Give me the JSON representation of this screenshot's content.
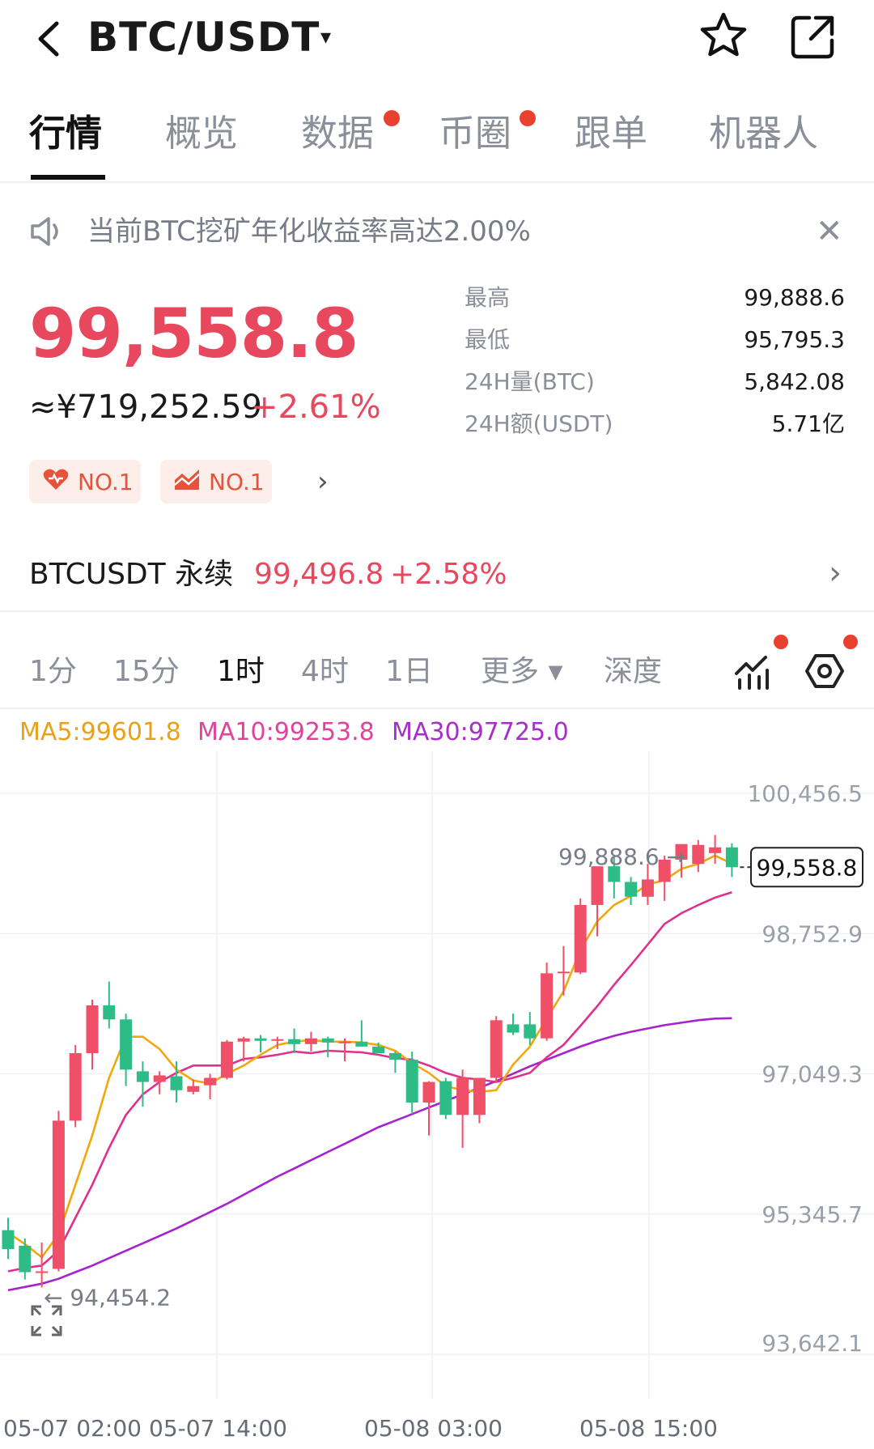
{
  "header": {
    "pair": "BTC/USDT",
    "dropdown_glyph": "▾",
    "icons": [
      "back-icon",
      "star-icon",
      "share-icon"
    ]
  },
  "tabs": [
    {
      "label": "行情",
      "active": true,
      "dot": false
    },
    {
      "label": "概览",
      "active": false,
      "dot": false
    },
    {
      "label": "数据",
      "active": false,
      "dot": true
    },
    {
      "label": "币圈",
      "active": false,
      "dot": true
    },
    {
      "label": "跟单",
      "active": false,
      "dot": false
    },
    {
      "label": "机器人",
      "active": false,
      "dot": false
    }
  ],
  "notice": {
    "text": "当前BTC挖矿年化收益率高达2.00%",
    "close": "✕"
  },
  "ticker": {
    "price": "99,558.8",
    "cny": "≈¥719,252.59",
    "change": "+2.61%",
    "badges": [
      "NO.1",
      "NO.1"
    ],
    "badge_arrow": "›",
    "stats": [
      {
        "label": "最高",
        "value": "99,888.6"
      },
      {
        "label": "最低",
        "value": "95,795.3"
      },
      {
        "label": "24H量(BTC)",
        "value": "5,842.08"
      },
      {
        "label": "24H额(USDT)",
        "value": "5.71亿"
      }
    ]
  },
  "perpetual": {
    "name": "BTCUSDT 永续",
    "price": "99,496.8",
    "change": "+2.58%",
    "arrow": "›"
  },
  "intervals": [
    {
      "label": "1分",
      "active": false
    },
    {
      "label": "15分",
      "active": false
    },
    {
      "label": "1时",
      "active": true
    },
    {
      "label": "4时",
      "active": false
    },
    {
      "label": "1日",
      "active": false
    },
    {
      "label": "更多 ▾",
      "active": false
    },
    {
      "label": "深度",
      "active": false
    }
  ],
  "ma_legend": [
    {
      "label": "MA5:99601.8",
      "color": "#e8a21a"
    },
    {
      "label": "MA10:99253.8",
      "color": "#e0439a"
    },
    {
      "label": "MA30:97725.0",
      "color": "#a72fc9"
    }
  ],
  "colors": {
    "up": "#ef5068",
    "down": "#2dbc85",
    "ma5": "#f0a80c",
    "ma10": "#e0308e",
    "ma30": "#a722cf"
  },
  "chart_data": {
    "type": "candlestick",
    "y_ticks": [
      "100,456.5",
      "98,752.9",
      "97,049.3",
      "95,345.7",
      "93,642.1"
    ],
    "y_tick_values": [
      100456.5,
      98752.9,
      97049.3,
      95345.7,
      93642.1
    ],
    "ylim": [
      93642.1,
      100456.5
    ],
    "x_ticks": [
      "05-07 02:00",
      "05-07 14:00",
      "05-08 03:00",
      "05-08 15:00"
    ],
    "high_label": "99,888.6 →",
    "low_label": "← 94,454.2",
    "last_price_label": "99,558.8",
    "last_price": 99558.8,
    "candles": [
      {
        "o": 95150,
        "h": 95300,
        "l": 94800,
        "c": 94920
      },
      {
        "o": 94960,
        "h": 95050,
        "l": 94550,
        "c": 94640
      },
      {
        "o": 94630,
        "h": 95000,
        "l": 94454.2,
        "c": 94650
      },
      {
        "o": 94680,
        "h": 96600,
        "l": 94650,
        "c": 96480
      },
      {
        "o": 96480,
        "h": 97400,
        "l": 96400,
        "c": 97300
      },
      {
        "o": 97300,
        "h": 97950,
        "l": 97100,
        "c": 97880
      },
      {
        "o": 97880,
        "h": 98170,
        "l": 97600,
        "c": 97710
      },
      {
        "o": 97710,
        "h": 97780,
        "l": 96900,
        "c": 97100
      },
      {
        "o": 97080,
        "h": 97200,
        "l": 96650,
        "c": 96950
      },
      {
        "o": 96950,
        "h": 97080,
        "l": 96800,
        "c": 97030
      },
      {
        "o": 97020,
        "h": 97200,
        "l": 96700,
        "c": 96850
      },
      {
        "o": 96830,
        "h": 96980,
        "l": 96800,
        "c": 96900
      },
      {
        "o": 96910,
        "h": 97050,
        "l": 96740,
        "c": 97000
      },
      {
        "o": 97000,
        "h": 97460,
        "l": 96980,
        "c": 97440
      },
      {
        "o": 97440,
        "h": 97500,
        "l": 97200,
        "c": 97480
      },
      {
        "o": 97480,
        "h": 97520,
        "l": 97310,
        "c": 97450
      },
      {
        "o": 97450,
        "h": 97500,
        "l": 97350,
        "c": 97470
      },
      {
        "o": 97470,
        "h": 97600,
        "l": 97300,
        "c": 97410
      },
      {
        "o": 97410,
        "h": 97560,
        "l": 97320,
        "c": 97480
      },
      {
        "o": 97480,
        "h": 97500,
        "l": 97250,
        "c": 97430
      },
      {
        "o": 97430,
        "h": 97480,
        "l": 97200,
        "c": 97440
      },
      {
        "o": 97440,
        "h": 97700,
        "l": 97400,
        "c": 97380
      },
      {
        "o": 97380,
        "h": 97430,
        "l": 97300,
        "c": 97300
      },
      {
        "o": 97300,
        "h": 97320,
        "l": 97060,
        "c": 97220
      },
      {
        "o": 97220,
        "h": 97320,
        "l": 96560,
        "c": 96700
      },
      {
        "o": 96700,
        "h": 96960,
        "l": 96300,
        "c": 96950
      },
      {
        "o": 96960,
        "h": 97000,
        "l": 96500,
        "c": 96550
      },
      {
        "o": 96550,
        "h": 97100,
        "l": 96150,
        "c": 97000
      },
      {
        "o": 96550,
        "h": 97000,
        "l": 96450,
        "c": 97000
      },
      {
        "o": 97000,
        "h": 97750,
        "l": 96950,
        "c": 97700
      },
      {
        "o": 97650,
        "h": 97780,
        "l": 97520,
        "c": 97550
      },
      {
        "o": 97650,
        "h": 97800,
        "l": 97400,
        "c": 97480
      },
      {
        "o": 97480,
        "h": 98400,
        "l": 97450,
        "c": 98270
      },
      {
        "o": 98270,
        "h": 98600,
        "l": 98000,
        "c": 98290
      },
      {
        "o": 98280,
        "h": 99180,
        "l": 98260,
        "c": 99100
      },
      {
        "o": 99100,
        "h": 99470,
        "l": 98720,
        "c": 99570
      },
      {
        "o": 99570,
        "h": 99710,
        "l": 99180,
        "c": 99380
      },
      {
        "o": 99380,
        "h": 99440,
        "l": 99100,
        "c": 99200
      },
      {
        "o": 99200,
        "h": 99600,
        "l": 99100,
        "c": 99410
      },
      {
        "o": 99380,
        "h": 99700,
        "l": 99150,
        "c": 99650
      },
      {
        "o": 99650,
        "h": 99820,
        "l": 99430,
        "c": 99840
      },
      {
        "o": 99600,
        "h": 99888.6,
        "l": 99500,
        "c": 99830
      },
      {
        "o": 99730,
        "h": 99950,
        "l": 99600,
        "c": 99800
      },
      {
        "o": 99800,
        "h": 99850,
        "l": 99440,
        "c": 99558.8
      }
    ],
    "ma5": [
      95120,
      94980,
      94820,
      95100,
      95700,
      96300,
      97000,
      97500,
      97500,
      97350,
      97100,
      96970,
      96930,
      97050,
      97150,
      97280,
      97400,
      97440,
      97460,
      97440,
      97440,
      97430,
      97400,
      97330,
      97180,
      97060,
      96900,
      96850,
      96830,
      96850,
      97160,
      97380,
      97720,
      98050,
      98550,
      98900,
      99100,
      99210,
      99350,
      99400,
      99540,
      99600,
      99700,
      99601.8
    ],
    "ma10": [
      94650,
      94690,
      94720,
      94900,
      95300,
      95700,
      96150,
      96550,
      96800,
      96950,
      97060,
      97150,
      97150,
      97150,
      97230,
      97250,
      97280,
      97320,
      97300,
      97330,
      97320,
      97310,
      97280,
      97240,
      97220,
      97150,
      97060,
      97000,
      96980,
      96950,
      97000,
      97060,
      97250,
      97400,
      97630,
      97870,
      98130,
      98370,
      98620,
      98870,
      99000,
      99100,
      99190,
      99253.8
    ],
    "ma30": [
      94420,
      94460,
      94500,
      94560,
      94640,
      94720,
      94810,
      94900,
      94990,
      95080,
      95170,
      95270,
      95370,
      95470,
      95580,
      95690,
      95800,
      95900,
      96000,
      96100,
      96200,
      96300,
      96400,
      96480,
      96560,
      96640,
      96720,
      96800,
      96880,
      96960,
      97050,
      97140,
      97220,
      97300,
      97380,
      97450,
      97510,
      97560,
      97600,
      97640,
      97670,
      97700,
      97720,
      97725.0
    ]
  }
}
